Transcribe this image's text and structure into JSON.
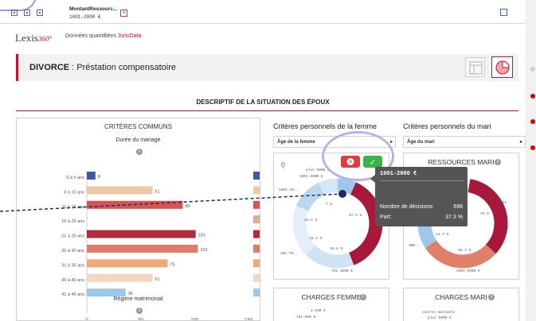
{
  "topbar": {
    "filter_title": "MontantRessourc...",
    "filter_value": "1001-2000 €",
    "close_glyph": "×"
  },
  "header": {
    "logo_main": "Lexis",
    "logo_sup": "360°",
    "subtitle_prefix": "Données quantifiées ",
    "subtitle_brand": "JurisData"
  },
  "title_band": {
    "case_type": "DIVORCE",
    "case_detail": " : Préstation compensatoire"
  },
  "section": {
    "title": "DESCRIPTIF DE LA SITUATION DES ÉPOUX"
  },
  "common": {
    "title": "CRITÈRES COMMUNS",
    "subtitle": "Durée du mariage",
    "regime_label": "Régime matrimonial",
    "info_glyph": "i"
  },
  "wife": {
    "heading": "Critères personnels de la femme",
    "select_value": "Âge de la femme",
    "ressources_card": {
      "labels": [
        "plus 5000 €",
        "1001-2000 €",
        "1001-18..",
        "7 %",
        "11.5 %",
        "18.2 %",
        "18.8 %",
        "37.3 %",
        "301-75..",
        "751-1000 €"
      ]
    },
    "charges_title": "CHARGES FEMME",
    "charges_labels": [
      "1-100 €",
      "101-500 €"
    ]
  },
  "husband": {
    "heading": "Critères personnels du mari",
    "select_value": "Âge du mari",
    "ressources_title": "RESSOURCES MARI",
    "ressources_labels": [
      "751-1000 €",
      "1001-",
      "34 %",
      "14.7 %",
      "28.7 %",
      "300...",
      "2001-5000 €"
    ],
    "charges_title": "CHARGES MARI",
    "charges_labels": [
      "Autres montants",
      "plus 5000 €"
    ]
  },
  "tooltip": {
    "title": "1001-2000 €",
    "row1_label": "Nombre de décisions:",
    "row1_value": "698",
    "row2_label": "Part:",
    "row2_value": "37.3 %"
  },
  "buttons": {
    "cancel_glyph": "✕",
    "ok_glyph": "✓"
  },
  "colors": {
    "accent": "#c8102e",
    "dark_red": "#a8183a",
    "salmon": "#e0806a",
    "peach": "#f0c8a8",
    "light_blue": "#9ec8ea",
    "navy": "#3a5aa8"
  },
  "chart_data": {
    "type": "bar",
    "title": "Durée du mariage",
    "orientation": "horizontal",
    "categories": [
      "0 à 5 ans",
      "6 à 10 ans",
      "11 à 15 ans",
      "16 à 20 ans",
      "21 à 25 ans",
      "26 à 30 ans",
      "31 à 35 ans",
      "36 à 40 ans",
      "41 à 45 ans"
    ],
    "values": [
      8,
      61,
      89,
      null,
      101,
      103,
      75,
      61,
      36
    ],
    "value_labels": [
      "8",
      "61",
      "89",
      "",
      "101",
      "103",
      "75",
      "61",
      "36"
    ],
    "xticks": [
      "0",
      "50",
      "100",
      "150"
    ],
    "xlim": [
      0,
      150
    ]
  }
}
